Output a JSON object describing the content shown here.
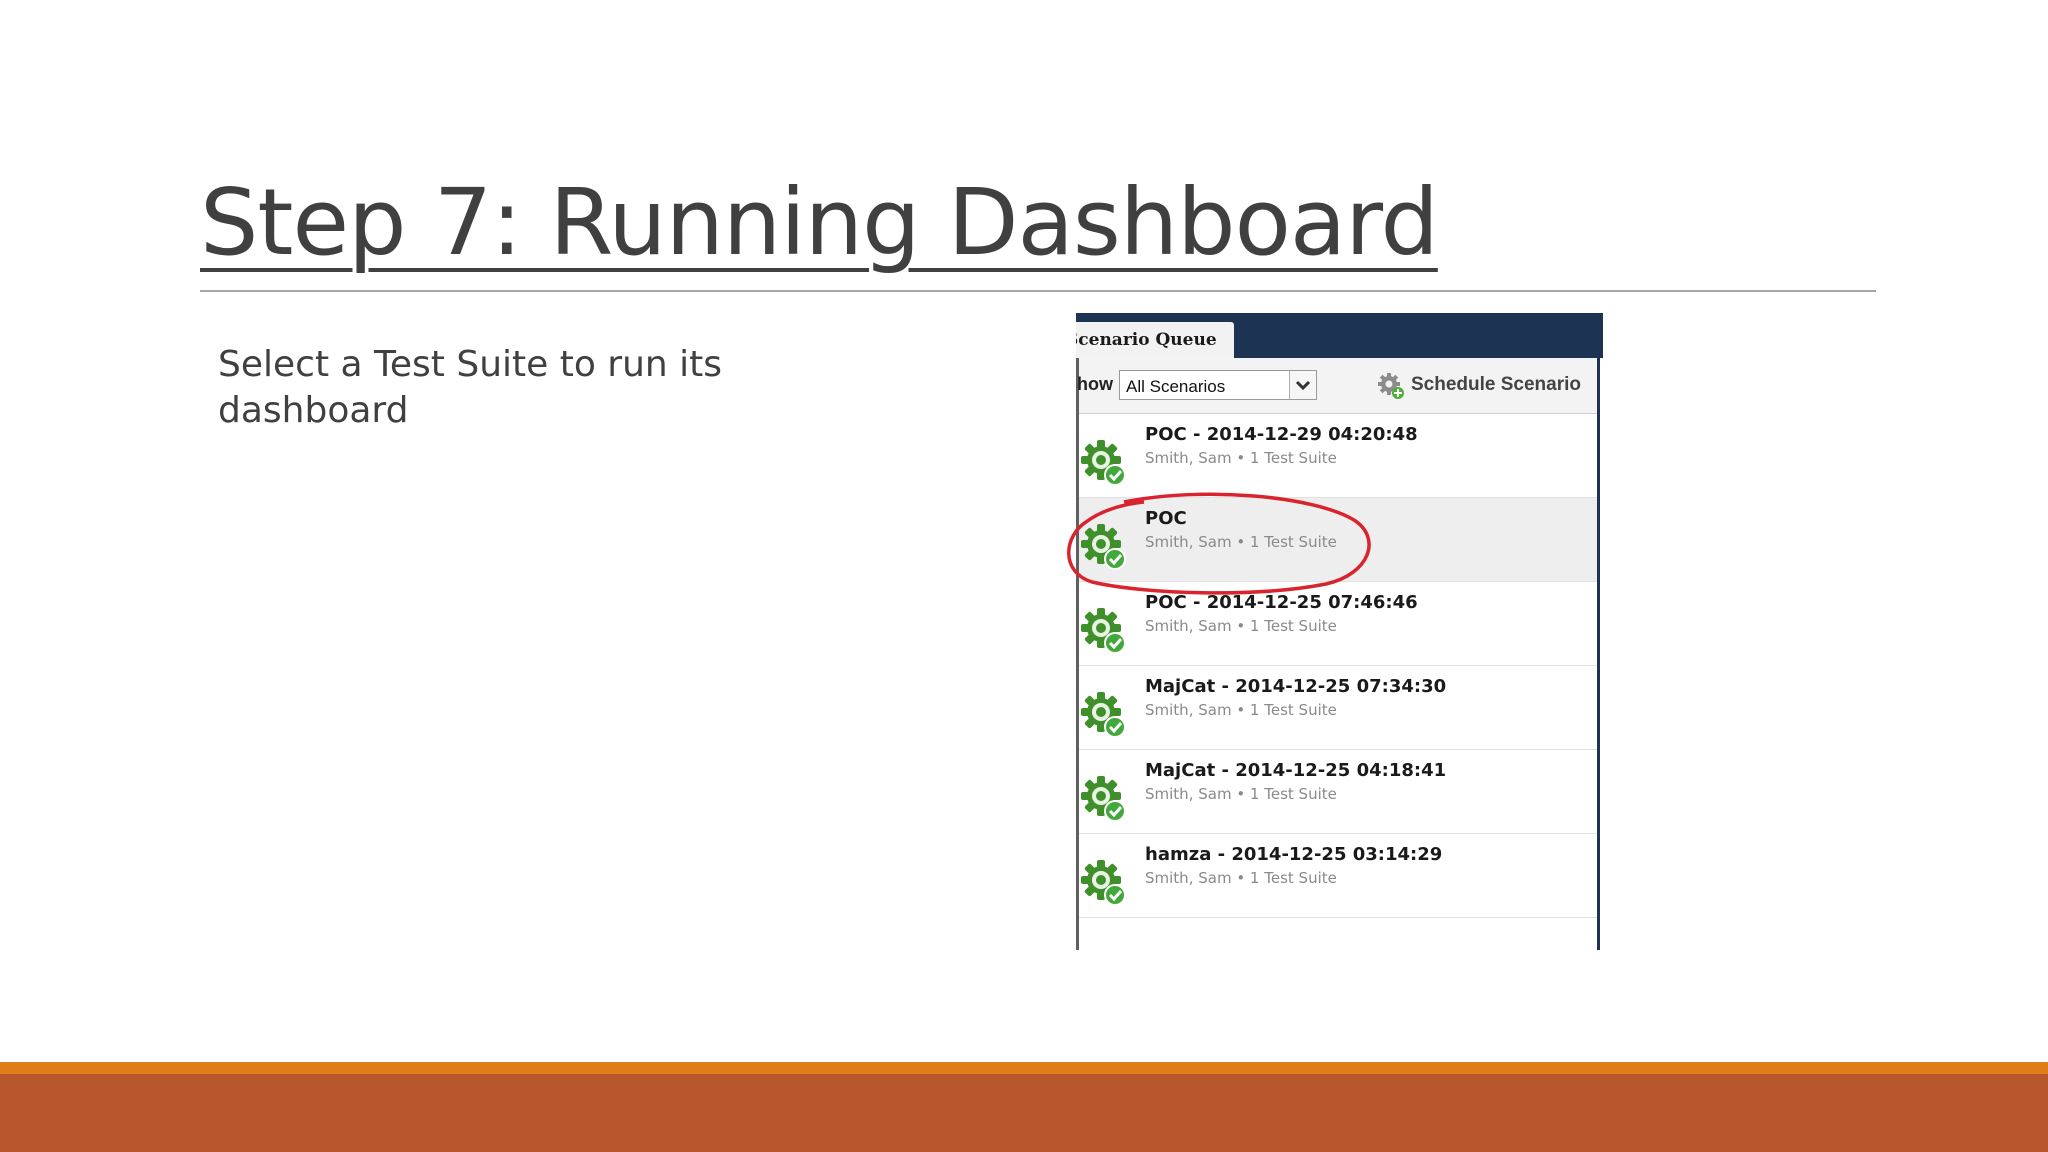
{
  "slide": {
    "title": "Step 7: Running Dashboard",
    "body": "Select a Test Suite to run its dashboard"
  },
  "screenshot": {
    "tab_label": "Scenario Queue",
    "show_label": "Show",
    "filter_value": "All Scenarios",
    "schedule_label": "Schedule Scenario",
    "scenarios": [
      {
        "name": "POC - 2014-12-29 04:20:48",
        "meta": "Smith, Sam • 1 Test Suite",
        "selected": false
      },
      {
        "name": "POC",
        "meta": "Smith, Sam • 1 Test Suite",
        "selected": true
      },
      {
        "name": "POC - 2014-12-25 07:46:46",
        "meta": "Smith, Sam • 1 Test Suite",
        "selected": false
      },
      {
        "name": "MajCat - 2014-12-25 07:34:30",
        "meta": "Smith, Sam • 1 Test Suite",
        "selected": false
      },
      {
        "name": "MajCat - 2014-12-25 04:18:41",
        "meta": "Smith, Sam • 1 Test Suite",
        "selected": false
      },
      {
        "name": "hamza - 2014-12-25 03:14:29",
        "meta": "Smith, Sam • 1 Test Suite",
        "selected": false
      }
    ]
  },
  "icons": {
    "status": "gear-check-icon",
    "schedule": "gear-plus-icon",
    "dropdown": "chevron-down-icon"
  },
  "colors": {
    "header_navy": "#1c3354",
    "gear_green": "#3f8f2a",
    "highlight_red": "#d9232d",
    "footer_orange": "#e07d1a",
    "footer_rust": "#b8572c"
  }
}
